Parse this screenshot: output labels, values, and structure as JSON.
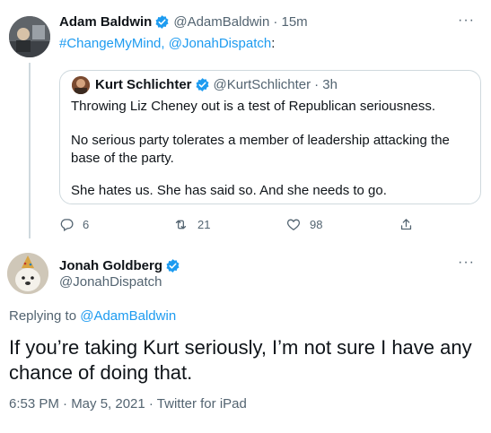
{
  "parent_tweet": {
    "author_name": "Adam Baldwin",
    "author_handle": "@AdamBaldwin",
    "time": "· 15m",
    "text_hashtag": "#ChangeMyMind",
    "text_separator": ", ",
    "text_mention": "@JonahDispatch",
    "text_colon": ":",
    "more_icon": "more-dots-icon",
    "quoted": {
      "author_name": "Kurt Schlichter",
      "author_handle": "@KurtSchlichter",
      "time": "· 3h",
      "line1": "Throwing Liz Cheney out is a test of Republican seriousness.",
      "line2": "No serious party tolerates a member of leadership attacking the base of the party.",
      "line3": "She hates us. She has said so. And she needs to go."
    },
    "actions": {
      "replies": "6",
      "retweets": "21",
      "likes": "98"
    }
  },
  "main_tweet": {
    "author_name": "Jonah Goldberg",
    "author_handle": "@JonahDispatch",
    "replying_prefix": "Replying to ",
    "replying_to": "@AdamBaldwin",
    "text": "If you’re taking Kurt seriously, I’m not sure I have any chance of doing that.",
    "timestamp": "6:53 PM · May 5, 2021 · Twitter for iPad"
  },
  "colors": {
    "accent": "#1d9bf0",
    "muted": "#536471",
    "border": "#cfd9de",
    "text": "#0f1419"
  }
}
